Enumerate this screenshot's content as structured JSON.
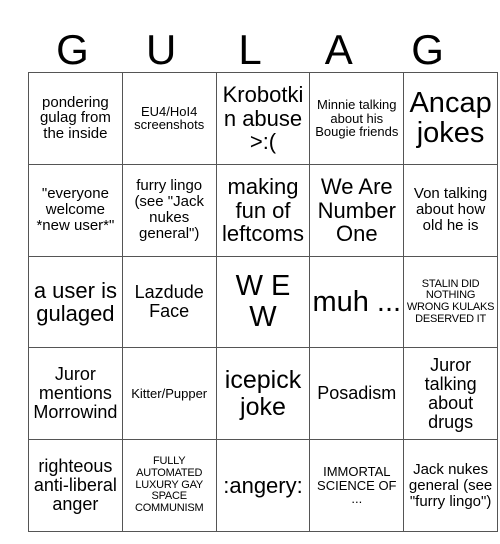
{
  "card": {
    "header_letters": [
      "G",
      "U",
      "L",
      "A",
      "G"
    ],
    "columns": 5,
    "rows": 5,
    "cells": [
      [
        {
          "text": "pondering gulag from the inside",
          "size": "s"
        },
        {
          "text": "EU4/HoI4 screenshots",
          "size": "xs"
        },
        {
          "text": "Krobotkin abuse >:(",
          "size": "l"
        },
        {
          "text": "Minnie talking about his Bougie friends",
          "size": "xs"
        },
        {
          "text": "Ancap jokes",
          "size": "xxl"
        }
      ],
      [
        {
          "text": "\"everyone welcome *new user*\"",
          "size": "s"
        },
        {
          "text": "furry lingo (see \"Jack nukes general\")",
          "size": "s"
        },
        {
          "text": "making fun of leftcoms",
          "size": "l"
        },
        {
          "text": "We Are Number One",
          "size": "l"
        },
        {
          "text": "Von talking about how old he is",
          "size": "s"
        }
      ],
      [
        {
          "text": "a user is gulaged",
          "size": "l"
        },
        {
          "text": "Lazdude Face",
          "size": "m"
        },
        {
          "text": "W E W",
          "size": "xxl"
        },
        {
          "text": "muh ...",
          "size": "xxl"
        },
        {
          "text": "STALIN DID NOTHING WRONG KULAKS DESERVED IT",
          "size": "xxs"
        }
      ],
      [
        {
          "text": "Juror mentions Morrowind",
          "size": "m"
        },
        {
          "text": "Kitter/Pupper",
          "size": "xs"
        },
        {
          "text": "icepick joke",
          "size": "xl"
        },
        {
          "text": "Posadism",
          "size": "m"
        },
        {
          "text": "Juror talking about drugs",
          "size": "m"
        }
      ],
      [
        {
          "text": "righteous anti-liberal anger",
          "size": "m"
        },
        {
          "text": "FULLY AUTOMATED LUXURY GAY SPACE COMMUNISM",
          "size": "xxs"
        },
        {
          "text": ":angery:",
          "size": "l"
        },
        {
          "text": "IMMORTAL SCIENCE OF ...",
          "size": "xs"
        },
        {
          "text": "Jack nukes general (see \"furry lingo\")",
          "size": "s"
        }
      ]
    ]
  },
  "colors": {
    "background": "#ffffff",
    "text": "#000000",
    "grid_line": "#555555"
  }
}
